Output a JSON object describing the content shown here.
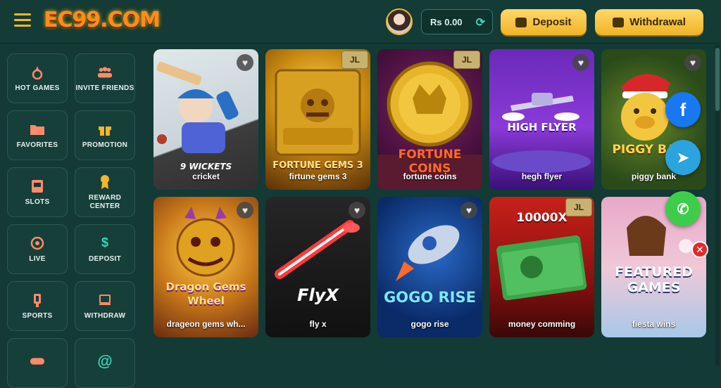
{
  "header": {
    "logo": "EC99.COM",
    "balance": "Rs 0.00",
    "deposit_label": "Deposit",
    "withdraw_label": "Withdrawal"
  },
  "sidebar": {
    "items": [
      {
        "label": "HOT GAMES",
        "icon": "fire-icon"
      },
      {
        "label": "INVITE FRIENDS",
        "icon": "users-icon"
      },
      {
        "label": "FAVORITES",
        "icon": "folder-icon"
      },
      {
        "label": "PROMOTION",
        "icon": "gift-icon"
      },
      {
        "label": "SLOTS",
        "icon": "slot-icon"
      },
      {
        "label": "REWARD CENTER",
        "icon": "medal-icon"
      },
      {
        "label": "LIVE",
        "icon": "live-icon"
      },
      {
        "label": "DEPOSIT",
        "icon": "dollar-icon"
      },
      {
        "label": "SPORTS",
        "icon": "sports-icon"
      },
      {
        "label": "WITHDRAW",
        "icon": "monitor-icon"
      },
      {
        "label": "",
        "icon": "gamepad-icon"
      },
      {
        "label": "",
        "icon": "at-icon"
      }
    ]
  },
  "games": [
    {
      "name": "cricket",
      "art_text": "9 WICKETS",
      "badge": ""
    },
    {
      "name": "firtune gems 3",
      "art_text": "FORTUNE GEMS 3",
      "badge": "JL"
    },
    {
      "name": "fortune coins",
      "art_text": "FORTUNE COINS",
      "badge": "JL"
    },
    {
      "name": "hegh flyer",
      "art_text": "HIGH FLYER",
      "badge": ""
    },
    {
      "name": "piggy bank",
      "art_text": "PIGGY BANK",
      "badge": ""
    },
    {
      "name": "drageon gems wh...",
      "art_text": "Dragon Gems Wheel",
      "badge": ""
    },
    {
      "name": "fly x",
      "art_text": "FlyX",
      "badge": ""
    },
    {
      "name": "gogo rise",
      "art_text": "GOGO RISE",
      "badge": ""
    },
    {
      "name": "money comming",
      "art_text": "10000X",
      "badge": "JL"
    },
    {
      "name": "fiesta wins",
      "art_text": "FEATURED GAMES",
      "badge": ""
    }
  ],
  "social": {
    "facebook": "f",
    "telegram": "➤",
    "whatsapp": "✆"
  },
  "colors": {
    "accent": "#f3b62c",
    "background": "#133a34",
    "brand": "#ff8c1a"
  }
}
